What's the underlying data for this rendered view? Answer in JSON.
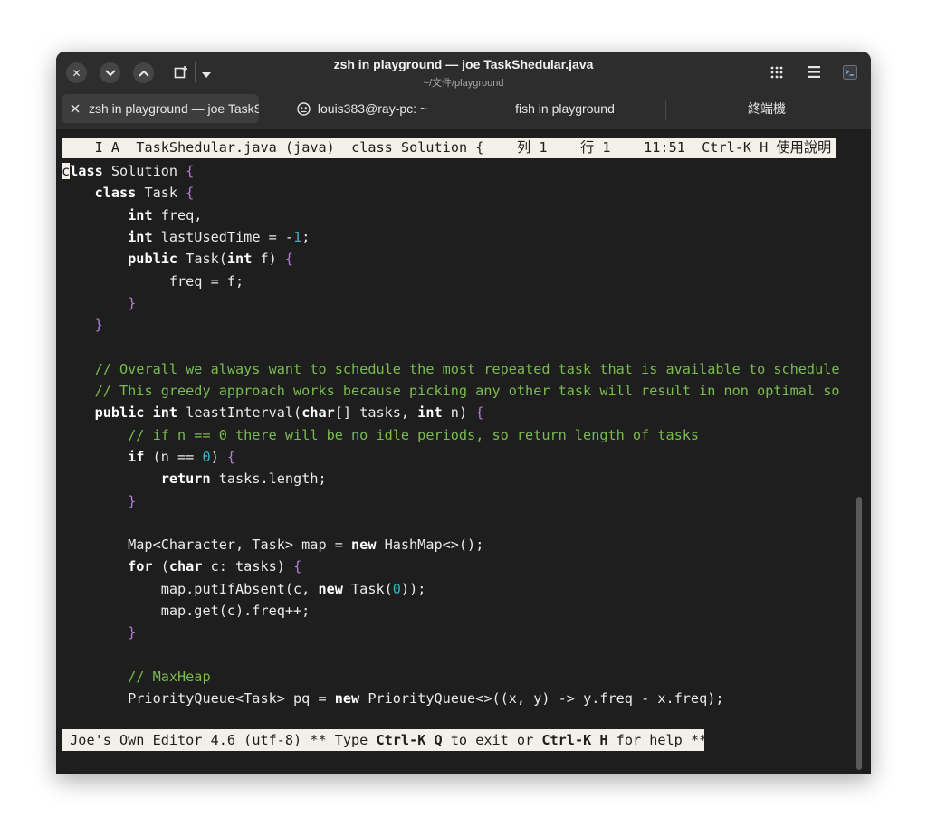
{
  "window": {
    "title": "zsh in playground — joe TaskShedular.java",
    "subtitle": "~/文件/playground"
  },
  "tabs": [
    {
      "label": "zsh in playground — joe TaskShedular.java",
      "active": true
    },
    {
      "label": "louis383@ray-pc: ~",
      "active": false
    },
    {
      "label": "fish in playground",
      "active": false
    },
    {
      "label": "終端機",
      "active": false
    }
  ],
  "editor": {
    "status": {
      "mode": "I A",
      "filename": "TaskShedular.java",
      "filetype": "(java)",
      "context": "class Solution {",
      "col_label": "列",
      "col": "1",
      "row_label": "行",
      "row": "1",
      "time": "11:51",
      "help_key": "Ctrl-K H",
      "help_label": "使用說明"
    },
    "help_bar": {
      "prefix": "Joe's Own Editor 4.6 (utf-8) ** Type ",
      "key_exit": "Ctrl-K Q",
      "middle": " to exit or ",
      "key_help": "Ctrl-K H",
      "suffix": " for help **"
    },
    "lines": [
      [
        [
          "c",
          "cursor"
        ],
        [
          "lass",
          "kw"
        ],
        [
          " Solution ",
          ""
        ],
        [
          "{",
          "br"
        ]
      ],
      [
        [
          "    ",
          ""
        ],
        [
          "class",
          "kw"
        ],
        [
          " Task ",
          ""
        ],
        [
          "{",
          "br"
        ]
      ],
      [
        [
          "        ",
          ""
        ],
        [
          "int",
          "kw"
        ],
        [
          " freq,",
          ""
        ]
      ],
      [
        [
          "        ",
          ""
        ],
        [
          "int",
          "kw"
        ],
        [
          " lastUsedTime = -",
          ""
        ],
        [
          "1",
          "num"
        ],
        [
          ";",
          ""
        ]
      ],
      [
        [
          "        ",
          ""
        ],
        [
          "public",
          "kw"
        ],
        [
          " Task(",
          ""
        ],
        [
          "int",
          "kw"
        ],
        [
          " f) ",
          ""
        ],
        [
          "{",
          "br"
        ]
      ],
      [
        [
          "             freq = f;",
          ""
        ]
      ],
      [
        [
          "        ",
          ""
        ],
        [
          "}",
          "br"
        ]
      ],
      [
        [
          "    ",
          ""
        ],
        [
          "}",
          "br"
        ]
      ],
      [
        [
          "",
          ""
        ]
      ],
      [
        [
          "    ",
          ""
        ],
        [
          "// Overall we always want to schedule the most repeated task that is available to schedule",
          "cm"
        ]
      ],
      [
        [
          "    ",
          ""
        ],
        [
          "// This greedy approach works because picking any other task will result in non optimal so",
          "cm"
        ]
      ],
      [
        [
          "    ",
          ""
        ],
        [
          "public",
          "kw"
        ],
        [
          " ",
          ""
        ],
        [
          "int",
          "kw"
        ],
        [
          " leastInterval(",
          ""
        ],
        [
          "char",
          "kw"
        ],
        [
          "[] tasks, ",
          ""
        ],
        [
          "int",
          "kw"
        ],
        [
          " n) ",
          ""
        ],
        [
          "{",
          "br"
        ]
      ],
      [
        [
          "        ",
          ""
        ],
        [
          "// if n == 0 there will be no idle periods, so return length of tasks",
          "cm"
        ]
      ],
      [
        [
          "        ",
          ""
        ],
        [
          "if",
          "kw"
        ],
        [
          " (n == ",
          ""
        ],
        [
          "0",
          "num"
        ],
        [
          ") ",
          ""
        ],
        [
          "{",
          "br"
        ]
      ],
      [
        [
          "            ",
          ""
        ],
        [
          "return",
          "kw"
        ],
        [
          " tasks.length;",
          ""
        ]
      ],
      [
        [
          "        ",
          ""
        ],
        [
          "}",
          "br"
        ]
      ],
      [
        [
          "",
          ""
        ]
      ],
      [
        [
          "        Map<Character, Task> map = ",
          ""
        ],
        [
          "new",
          "kw"
        ],
        [
          " HashMap<>();",
          ""
        ]
      ],
      [
        [
          "        ",
          ""
        ],
        [
          "for",
          "kw"
        ],
        [
          " (",
          ""
        ],
        [
          "char",
          "kw"
        ],
        [
          " c: tasks) ",
          ""
        ],
        [
          "{",
          "br"
        ]
      ],
      [
        [
          "            map.putIfAbsent(c, ",
          ""
        ],
        [
          "new",
          "kw"
        ],
        [
          " Task(",
          ""
        ],
        [
          "0",
          "num"
        ],
        [
          "));",
          ""
        ]
      ],
      [
        [
          "            map.get(c).freq++;",
          ""
        ]
      ],
      [
        [
          "        ",
          ""
        ],
        [
          "}",
          "br"
        ]
      ],
      [
        [
          "",
          ""
        ]
      ],
      [
        [
          "        ",
          ""
        ],
        [
          "// MaxHeap",
          "cm"
        ]
      ],
      [
        [
          "        PriorityQueue<Task> pq = ",
          ""
        ],
        [
          "new",
          "kw"
        ],
        [
          " PriorityQueue<>((x, y) -> y.freq - x.freq);",
          ""
        ]
      ]
    ]
  },
  "colors": {
    "background": "#1e1e1e",
    "keyword": "#ffffff",
    "brace": "#b57ed6",
    "number": "#3ab0c4",
    "comment": "#79bb4f",
    "status_bg": "#f2f0e8"
  },
  "icons": {
    "close": "close-icon",
    "minimize": "chevron-down-icon",
    "maximize": "chevron-up-icon",
    "new_tab": "new-tab-icon",
    "dropdown": "dropdown-arrow-icon",
    "grid": "grid-icon",
    "menu": "hamburger-menu-icon",
    "terminal": "terminal-icon",
    "tab_close": "close-icon",
    "ghost": "ghost-icon"
  }
}
